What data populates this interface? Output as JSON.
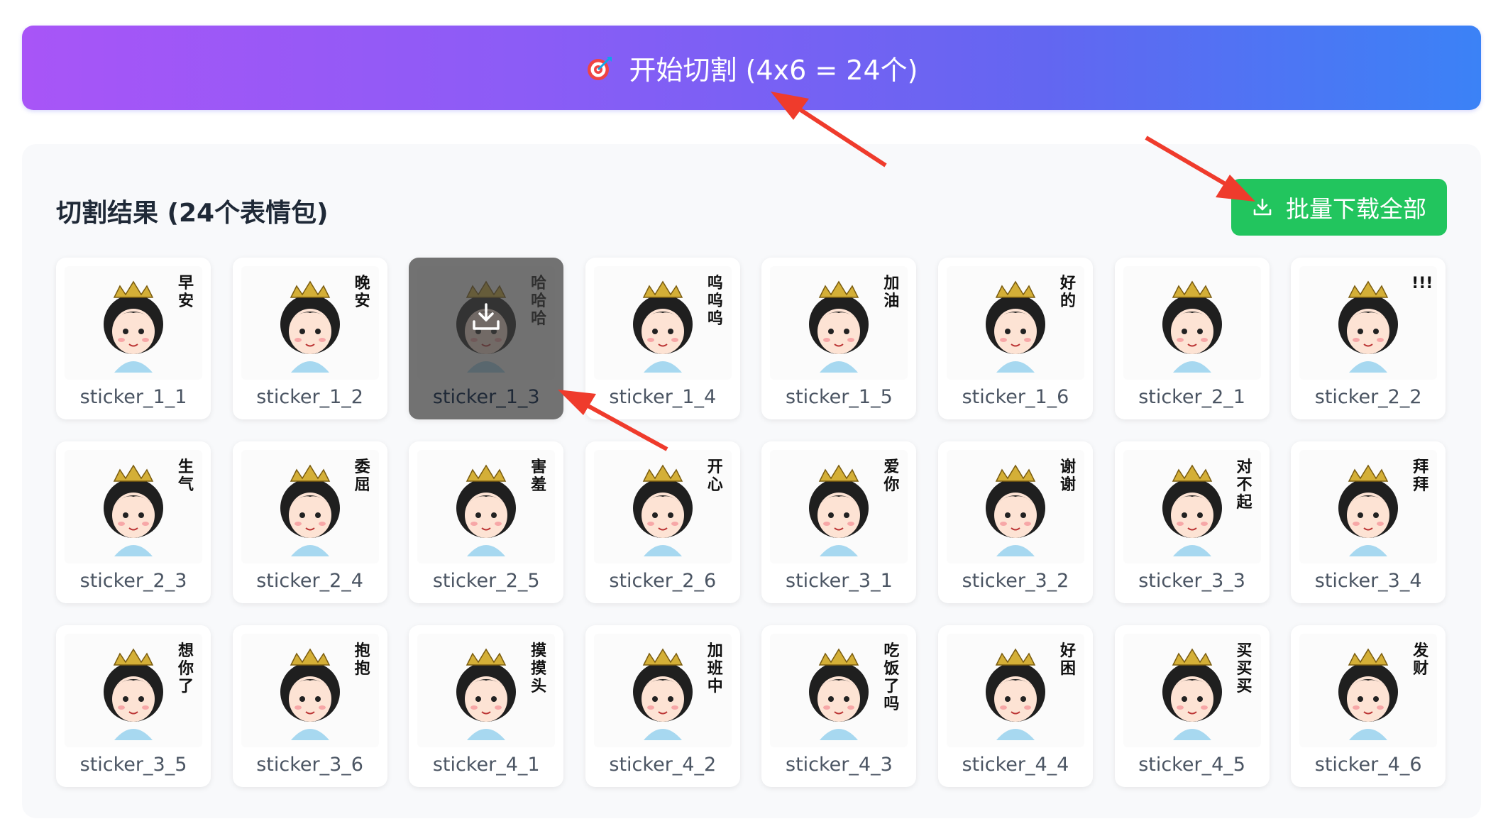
{
  "start_button": {
    "label": "开始切割 (4x6 = 24个)",
    "icon": "target-icon"
  },
  "results": {
    "title": "切割结果 (24个表情包)",
    "download_all_label": "批量下载全部",
    "download_icon": "download-icon",
    "hovered_index": 2,
    "stickers": [
      {
        "name": "sticker_1_1",
        "caption": "早安"
      },
      {
        "name": "sticker_1_2",
        "caption": "晚安"
      },
      {
        "name": "sticker_1_3",
        "caption": "哈哈哈"
      },
      {
        "name": "sticker_1_4",
        "caption": "呜呜呜"
      },
      {
        "name": "sticker_1_5",
        "caption": "加油"
      },
      {
        "name": "sticker_1_6",
        "caption": "好的"
      },
      {
        "name": "sticker_2_1",
        "caption": ""
      },
      {
        "name": "sticker_2_2",
        "caption": "!!!"
      },
      {
        "name": "sticker_2_3",
        "caption": "生气"
      },
      {
        "name": "sticker_2_4",
        "caption": "委屈"
      },
      {
        "name": "sticker_2_5",
        "caption": "害羞"
      },
      {
        "name": "sticker_2_6",
        "caption": "开心"
      },
      {
        "name": "sticker_3_1",
        "caption": "爱你"
      },
      {
        "name": "sticker_3_2",
        "caption": "谢谢"
      },
      {
        "name": "sticker_3_3",
        "caption": "对不起"
      },
      {
        "name": "sticker_3_4",
        "caption": "拜拜"
      },
      {
        "name": "sticker_3_5",
        "caption": "想你了"
      },
      {
        "name": "sticker_3_6",
        "caption": "抱抱"
      },
      {
        "name": "sticker_4_1",
        "caption": "摸摸头"
      },
      {
        "name": "sticker_4_2",
        "caption": "加班中"
      },
      {
        "name": "sticker_4_3",
        "caption": "吃饭了吗"
      },
      {
        "name": "sticker_4_4",
        "caption": "好困"
      },
      {
        "name": "sticker_4_5",
        "caption": "买买买"
      },
      {
        "name": "sticker_4_6",
        "caption": "发财"
      }
    ]
  },
  "colors": {
    "gradient_start": "#a855f7",
    "gradient_end": "#3b82f6",
    "download_green": "#22c55e",
    "arrow_red": "#ef3b2c"
  }
}
